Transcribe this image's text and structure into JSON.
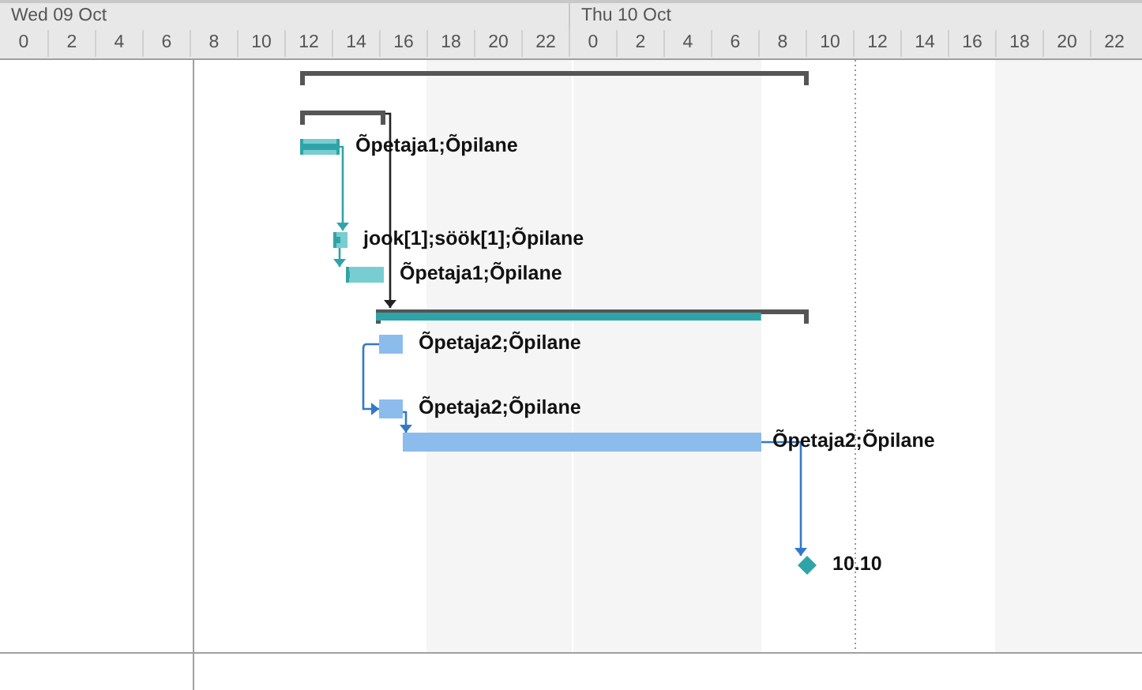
{
  "timescale": {
    "days": [
      {
        "label": "Wed 09 Oct"
      },
      {
        "label": "Thu 10 Oct"
      }
    ],
    "hours": [
      "0",
      "2",
      "4",
      "6",
      "8",
      "10",
      "12",
      "14",
      "16",
      "18",
      "20",
      "22",
      "0",
      "2",
      "4",
      "6",
      "8",
      "10",
      "12",
      "14",
      "16",
      "18",
      "20",
      "22"
    ]
  },
  "bars": [
    {
      "kind": "summary"
    },
    {
      "kind": "summary"
    },
    {
      "kind": "task",
      "critical": true,
      "level": 1,
      "label": "Õpetaja1;Õpilane"
    },
    {
      "kind": "task",
      "critical": true,
      "level": 0.5,
      "label": "jook[1];söök[1];Õpilane"
    },
    {
      "kind": "task",
      "critical": true,
      "level": 0.1,
      "label": "Õpetaja1;Õpilane"
    },
    {
      "kind": "summary",
      "level": 0.89
    },
    {
      "kind": "task",
      "critical": false,
      "label": "Õpetaja2;Õpilane"
    },
    {
      "kind": "task",
      "critical": false,
      "label": "Õpetaja2;Õpilane"
    },
    {
      "kind": "task",
      "critical": false,
      "label": "Õpetaja2;Õpilane"
    },
    {
      "kind": "milestone",
      "critical": true,
      "label": "10.10"
    }
  ]
}
